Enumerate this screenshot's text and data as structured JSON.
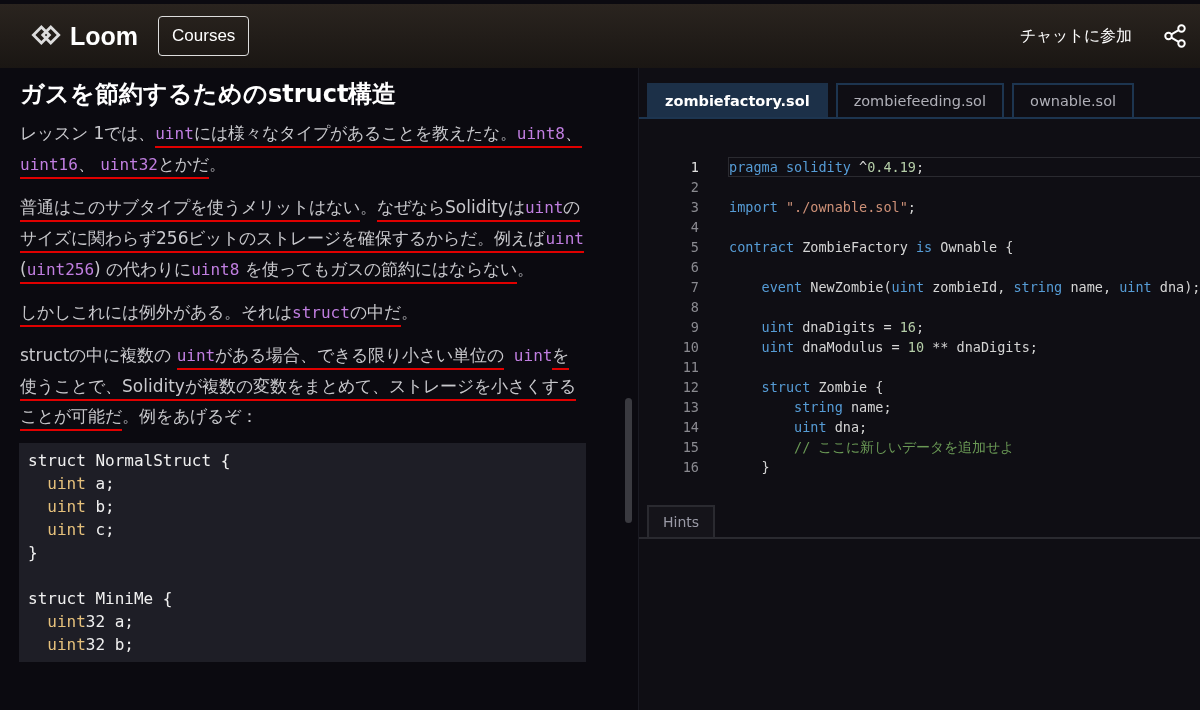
{
  "header": {
    "brand": "Loom",
    "courses_button": "Courses",
    "chat_link": "チャットに参加"
  },
  "lesson": {
    "title": "ガスを節約するためのstruct構造",
    "paragraphs": [
      [
        {
          "text": "レッスン 1では、",
          "code": false,
          "underlined": false
        },
        {
          "text": "uint",
          "code": true,
          "underlined": true
        },
        {
          "text": "には様々なタイプがあることを教えたな。",
          "code": false,
          "underlined": true
        },
        {
          "text": "uint8",
          "code": true,
          "underlined": true
        },
        {
          "text": "、 ",
          "code": false,
          "underlined": true
        },
        {
          "text": "uint16",
          "code": true,
          "underlined": true
        },
        {
          "text": "、 ",
          "code": false,
          "underlined": true
        },
        {
          "text": "uint32",
          "code": true,
          "underlined": true
        },
        {
          "text": "とかだ",
          "code": false,
          "underlined": true
        },
        {
          "text": "。",
          "code": false,
          "underlined": false
        }
      ],
      [
        {
          "text": "普通はこのサブタイプを使うメリットはない",
          "code": false,
          "underlined": true
        },
        {
          "text": "。",
          "code": false,
          "underlined": false
        },
        {
          "text": "なぜならSolidityは",
          "code": false,
          "underlined": true
        },
        {
          "text": "uint",
          "code": true,
          "underlined": true
        },
        {
          "text": "のサイズに関わらず256ビットのストレージを確保するからだ。例えば",
          "code": false,
          "underlined": true
        },
        {
          "text": "uint",
          "code": true,
          "underlined": true
        },
        {
          "text": " (",
          "code": false,
          "underlined": true
        },
        {
          "text": "uint256",
          "code": true,
          "underlined": true
        },
        {
          "text": ") の代わりに",
          "code": false,
          "underlined": true
        },
        {
          "text": "uint8",
          "code": true,
          "underlined": true
        },
        {
          "text": " を使ってもガスの節約にはならない",
          "code": false,
          "underlined": true
        },
        {
          "text": "。",
          "code": false,
          "underlined": false
        }
      ],
      [
        {
          "text": "しかしこれには例外がある。それは",
          "code": false,
          "underlined": true
        },
        {
          "text": "struct",
          "code": true,
          "underlined": true
        },
        {
          "text": "の中だ",
          "code": false,
          "underlined": true
        },
        {
          "text": "。",
          "code": false,
          "underlined": false
        }
      ],
      [
        {
          "text": "structの中に複数の ",
          "code": false,
          "underlined": false
        },
        {
          "text": "uint",
          "code": true,
          "underlined": true
        },
        {
          "text": "がある場合、できる限り小さい単位の",
          "code": false,
          "underlined": true
        },
        {
          "text": " uint",
          "code": true,
          "underlined": false
        },
        {
          "text": "を使うことで、Solidityが複数の変数をまとめて、ストレージを小さくすることが可能だ",
          "code": false,
          "underlined": true
        },
        {
          "text": "。例をあげるぞ：",
          "code": false,
          "underlined": false
        }
      ]
    ],
    "code_example": [
      [
        [
          {
            "text": "struct NormalStruct {",
            "kind": "plain"
          }
        ],
        [
          {
            "text": "  uint",
            "kind": "type"
          },
          {
            "text": " a;",
            "kind": "plain"
          }
        ],
        [
          {
            "text": "  uint",
            "kind": "type"
          },
          {
            "text": " b;",
            "kind": "plain"
          }
        ],
        [
          {
            "text": "  uint",
            "kind": "type"
          },
          {
            "text": " c;",
            "kind": "plain"
          }
        ],
        [
          {
            "text": "}",
            "kind": "plain"
          }
        ]
      ],
      [
        [
          {
            "text": "struct MiniMe {",
            "kind": "plain"
          }
        ],
        [
          {
            "text": "  uint",
            "kind": "type"
          },
          {
            "text": "32 a;",
            "kind": "plain"
          }
        ],
        [
          {
            "text": "  uint",
            "kind": "type"
          },
          {
            "text": "32 b;",
            "kind": "plain"
          }
        ]
      ]
    ]
  },
  "editor": {
    "tabs": [
      {
        "label": "zombiefactory.sol",
        "selected": true
      },
      {
        "label": "zombiefeeding.sol",
        "selected": false
      },
      {
        "label": "ownable.sol",
        "selected": false
      }
    ],
    "lines": [
      {
        "number": "1",
        "current": true,
        "tokens": [
          {
            "text": "pragma solidity",
            "kind": "keyword"
          },
          {
            "text": " ^",
            "kind": "plain"
          },
          {
            "text": "0.4.19",
            "kind": "number"
          },
          {
            "text": ";",
            "kind": "plain"
          }
        ]
      },
      {
        "number": "2",
        "current": false
      },
      {
        "number": "3",
        "current": false,
        "tokens": [
          {
            "text": "import",
            "kind": "keyword"
          },
          {
            "text": " \"./ownable.sol\"",
            "kind": "string"
          },
          {
            "text": ";",
            "kind": "plain"
          }
        ]
      },
      {
        "number": "4",
        "current": false
      },
      {
        "number": "5",
        "current": false,
        "tokens": [
          {
            "text": "contract",
            "kind": "keyword"
          },
          {
            "text": " ZombieFactory ",
            "kind": "plain"
          },
          {
            "text": "is",
            "kind": "keyword"
          },
          {
            "text": " Ownable {",
            "kind": "plain"
          }
        ]
      },
      {
        "number": "6",
        "current": false
      },
      {
        "number": "7",
        "current": false,
        "tokens": [
          {
            "text": "    event",
            "kind": "keyword"
          },
          {
            "text": " NewZombie(",
            "kind": "plain"
          },
          {
            "text": "uint",
            "kind": "keyword"
          },
          {
            "text": " zombieId, ",
            "kind": "plain"
          },
          {
            "text": "string",
            "kind": "keyword"
          },
          {
            "text": " name, ",
            "kind": "plain"
          },
          {
            "text": "uint",
            "kind": "keyword"
          },
          {
            "text": " dna);",
            "kind": "plain"
          }
        ]
      },
      {
        "number": "8",
        "current": false
      },
      {
        "number": "9",
        "current": false,
        "tokens": [
          {
            "text": "    uint",
            "kind": "keyword"
          },
          {
            "text": " dnaDigits = ",
            "kind": "plain"
          },
          {
            "text": "16",
            "kind": "number"
          },
          {
            "text": ";",
            "kind": "plain"
          }
        ]
      },
      {
        "number": "10",
        "current": false,
        "tokens": [
          {
            "text": "    uint",
            "kind": "keyword"
          },
          {
            "text": " dnaModulus = ",
            "kind": "plain"
          },
          {
            "text": "10",
            "kind": "number"
          },
          {
            "text": " ** dnaDigits;",
            "kind": "plain"
          }
        ]
      },
      {
        "number": "11",
        "current": false
      },
      {
        "number": "12",
        "current": false,
        "tokens": [
          {
            "text": "    struct",
            "kind": "keyword"
          },
          {
            "text": " Zombie {",
            "kind": "plain"
          }
        ]
      },
      {
        "number": "13",
        "current": false,
        "tokens": [
          {
            "text": "        string",
            "kind": "keyword"
          },
          {
            "text": " name;",
            "kind": "plain"
          }
        ]
      },
      {
        "number": "14",
        "current": false,
        "tokens": [
          {
            "text": "        uint",
            "kind": "keyword"
          },
          {
            "text": " dna;",
            "kind": "plain"
          }
        ]
      },
      {
        "number": "15",
        "current": false,
        "tokens": [
          {
            "text": "        // ここに新しいデータを追加せよ",
            "kind": "comment"
          }
        ]
      },
      {
        "number": "16",
        "current": false,
        "tokens": [
          {
            "text": "    }",
            "kind": "plain"
          }
        ]
      }
    ]
  },
  "hints_tab": {
    "label": "Hints",
    "selected": true
  }
}
